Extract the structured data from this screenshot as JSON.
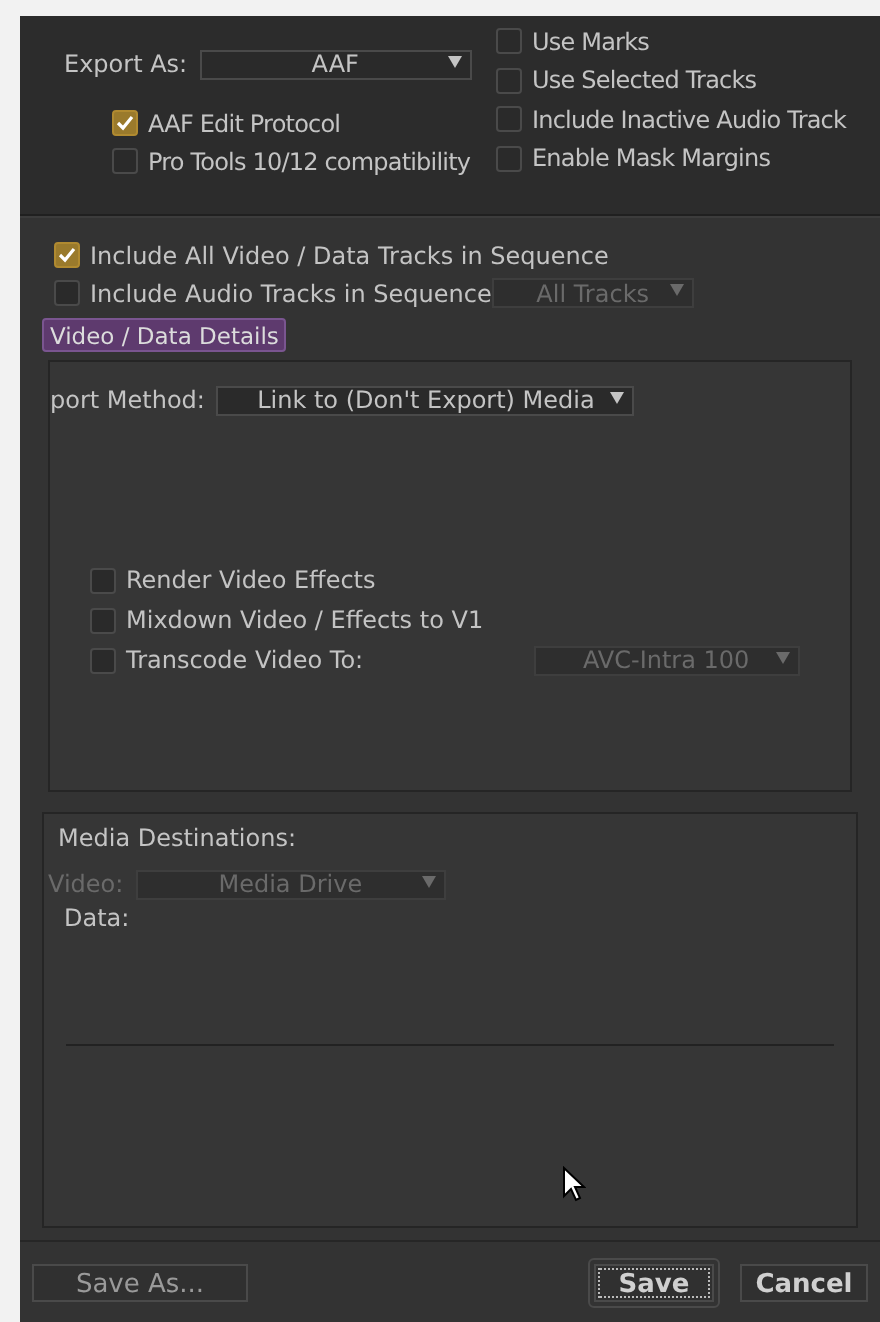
{
  "export_as": {
    "label": "Export As:",
    "value": "AAF"
  },
  "left_options": [
    {
      "label": "AAF Edit Protocol",
      "checked": true
    },
    {
      "label": "Pro Tools 10/12 compatibility",
      "checked": false
    }
  ],
  "right_options": [
    {
      "label": "Use Marks",
      "checked": false
    },
    {
      "label": "Use Selected Tracks",
      "checked": false
    },
    {
      "label": "Include Inactive Audio Track",
      "checked": false
    },
    {
      "label": "Enable Mask Margins",
      "checked": false
    }
  ],
  "sequence_options": [
    {
      "label": "Include All Video / Data Tracks in Sequence",
      "checked": true
    },
    {
      "label": "Include Audio Tracks in Sequence",
      "checked": false,
      "dropdown": {
        "value": "All Tracks",
        "disabled": true
      }
    }
  ],
  "details_button": {
    "label": "Video / Data Details",
    "selected": true
  },
  "export_method": {
    "label": "port Method:",
    "value": "Link to (Don't Export) Media"
  },
  "video_options": [
    {
      "label": "Render Video Effects",
      "checked": false
    },
    {
      "label": "Mixdown Video / Effects to V1",
      "checked": false
    },
    {
      "label": "Transcode Video To:",
      "checked": false,
      "dropdown": {
        "value": "AVC-Intra 100",
        "disabled": true
      }
    }
  ],
  "media_destinations": {
    "title": "Media Destinations:",
    "video": {
      "label": "Video:",
      "value": "Media Drive",
      "disabled": true
    },
    "data_label": "Data:"
  },
  "buttons": [
    {
      "label": "Save As...",
      "default": false
    },
    {
      "label": "Save",
      "default": true
    },
    {
      "label": "Cancel",
      "default": false
    }
  ]
}
